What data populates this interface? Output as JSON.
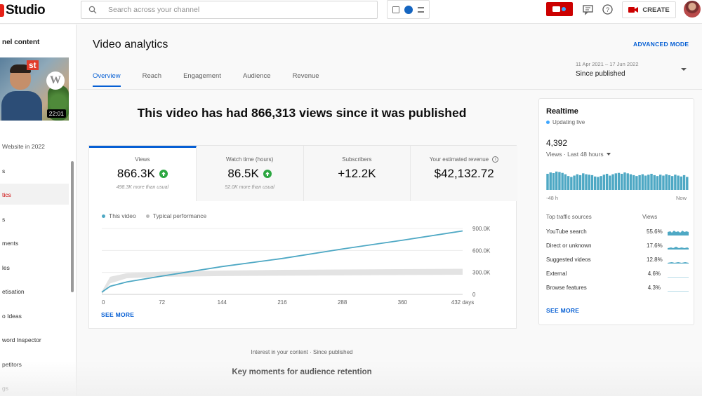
{
  "header": {
    "logo_text": "Studio",
    "search_placeholder": "Search across your channel",
    "create_label": "CREATE"
  },
  "sidebar": {
    "title": "nel content",
    "video_title": "Website in 2022",
    "thumb_badge": "st",
    "thumb_duration": "22:01",
    "items": [
      {
        "label": "s",
        "active": false
      },
      {
        "label": "tics",
        "active": true
      },
      {
        "label": "s",
        "active": false
      },
      {
        "label": "ments",
        "active": false
      },
      {
        "label": "les",
        "active": false
      },
      {
        "label": "etisation",
        "active": false
      },
      {
        "label": "o Ideas",
        "active": false
      },
      {
        "label": "word Inspector",
        "active": false
      },
      {
        "label": "petitors",
        "active": false
      },
      {
        "label": "gs",
        "active": false
      }
    ]
  },
  "main": {
    "title": "Video analytics",
    "advanced_mode": "ADVANCED MODE",
    "tabs": [
      {
        "label": "Overview",
        "active": true
      },
      {
        "label": "Reach",
        "active": false
      },
      {
        "label": "Engagement",
        "active": false
      },
      {
        "label": "Audience",
        "active": false
      },
      {
        "label": "Revenue",
        "active": false
      }
    ],
    "date_range": "11 Apr 2021 – 17 Jun 2022",
    "date_label": "Since published",
    "headline": "This video has had 866,313 views since it was published",
    "metrics": [
      {
        "label": "Views",
        "value": "866.3K",
        "sub": "498.3K more than usual",
        "up": true,
        "active": true
      },
      {
        "label": "Watch time (hours)",
        "value": "86.5K",
        "sub": "52.0K more than usual",
        "up": true,
        "active": false
      },
      {
        "label": "Subscribers",
        "value": "+12.2K",
        "sub": "",
        "up": false,
        "active": false
      },
      {
        "label": "Your estimated revenue",
        "value": "$42,132.72",
        "sub": "",
        "up": false,
        "active": false,
        "info": true
      }
    ],
    "legend": {
      "this_video": "This video",
      "typical": "Typical performance"
    },
    "see_more": "SEE MORE",
    "bottom_subtitle": "Interest in your content · Since published",
    "bottom_title": "Key moments for audience retention"
  },
  "chart_data": {
    "type": "line",
    "x_ticks": [
      "0",
      "72",
      "144",
      "216",
      "288",
      "360",
      "432 days"
    ],
    "y_ticks": [
      "0",
      "300.0K",
      "600.0K",
      "900.0K"
    ],
    "ylim": [
      0,
      900000
    ],
    "xlim": [
      0,
      432
    ],
    "series": [
      {
        "name": "This video",
        "color": "#4ea8c4",
        "x": [
          0,
          10,
          30,
          72,
          144,
          216,
          288,
          360,
          432
        ],
        "y": [
          30000,
          110000,
          170000,
          250000,
          380000,
          490000,
          620000,
          740000,
          866313
        ]
      },
      {
        "name": "Typical performance",
        "color": "#d8d8d8",
        "band_low": [
          0,
          150000,
          220000,
          240000,
          250000,
          255000,
          260000,
          265000,
          268000
        ],
        "band_high": [
          40000,
          240000,
          290000,
          310000,
          325000,
          335000,
          340000,
          345000,
          350000
        ],
        "x": [
          0,
          10,
          30,
          72,
          144,
          216,
          288,
          360,
          432
        ]
      }
    ]
  },
  "realtime": {
    "title": "Realtime",
    "live_label": "Updating live",
    "count": "4,392",
    "period": "Views · Last 48 hours",
    "bars": [
      72,
      78,
      75,
      82,
      80,
      76,
      70,
      62,
      58,
      64,
      70,
      66,
      74,
      70,
      68,
      66,
      60,
      58,
      62,
      68,
      72,
      64,
      70,
      74,
      76,
      72,
      78,
      74,
      70,
      66,
      62,
      66,
      70,
      64,
      68,
      72,
      66,
      62,
      68,
      64,
      70,
      66,
      62,
      68,
      64,
      60,
      66,
      58
    ],
    "axis_left": "-48 h",
    "axis_right": "Now",
    "sources_header": "Top traffic sources",
    "views_header": "Views",
    "sources": [
      {
        "name": "YouTube search",
        "pct": "55.6%"
      },
      {
        "name": "Direct or unknown",
        "pct": "17.6%"
      },
      {
        "name": "Suggested videos",
        "pct": "12.8%"
      },
      {
        "name": "External",
        "pct": "4.6%"
      },
      {
        "name": "Browse features",
        "pct": "4.3%"
      }
    ],
    "see_more": "SEE MORE",
    "accent": "#4ea8c4"
  }
}
